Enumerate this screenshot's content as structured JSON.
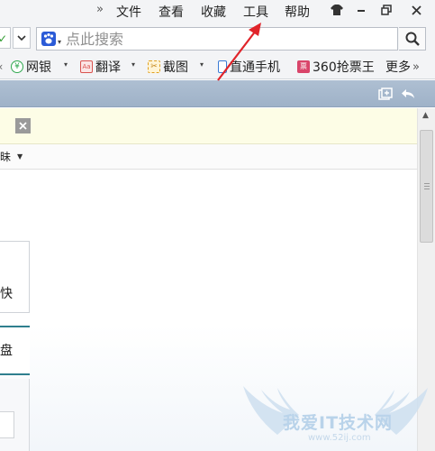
{
  "menubar": {
    "more_glyph": "»",
    "items": [
      "文件",
      "查看",
      "收藏",
      "工具",
      "帮助"
    ],
    "window_buttons": [
      "skin-icon",
      "minimize-icon",
      "restore-icon",
      "close-icon"
    ]
  },
  "search": {
    "placeholder": "点此搜索",
    "engine_icon": "baidu-paw-icon",
    "button_icon": "magnifier-icon"
  },
  "toolbar": {
    "items": [
      {
        "label": "网银",
        "icon": "bank-icon",
        "color": "#2fa84f"
      },
      {
        "label": "翻译",
        "icon": "translate-icon",
        "color": "#d9534f"
      },
      {
        "label": "截图",
        "icon": "scissors-icon",
        "color": "#e0a020"
      },
      {
        "label": "直通手机",
        "icon": "phone-icon",
        "color": "#3a7bd5"
      },
      {
        "label": "360抢票王",
        "icon": "ticket-icon",
        "color": "#d9456a"
      },
      {
        "label": "更多",
        "icon": "more-icon",
        "color": "#555555"
      }
    ],
    "more_glyph": "»"
  },
  "subbar": {
    "text": "昧"
  },
  "content": {
    "card1_text": "快",
    "card2_text": "盘"
  },
  "annotation": {
    "color": "#e0242a",
    "points_to": "工具"
  },
  "watermark": {
    "text": "我爱IT技术网",
    "url": "www.52ij.com"
  }
}
